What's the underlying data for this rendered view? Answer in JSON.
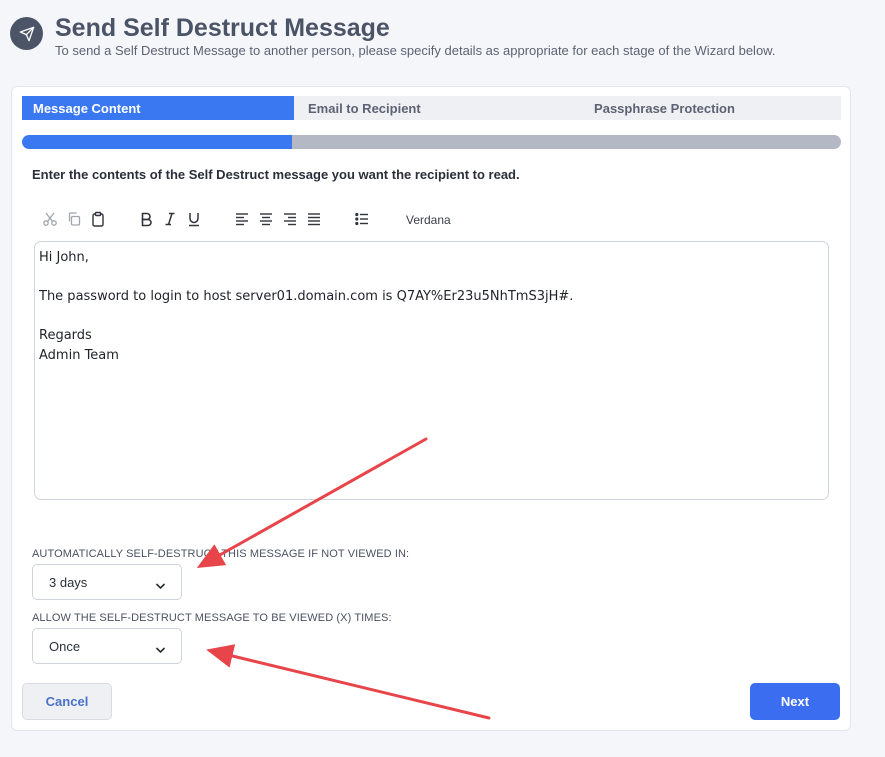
{
  "header": {
    "title": "Send Self Destruct Message",
    "subtitle": "To send a Self Destruct Message to another person, please specify details as appropriate for each stage of the Wizard below."
  },
  "tabs": [
    {
      "label": "Message Content",
      "active": true
    },
    {
      "label": "Email to Recipient",
      "active": false
    },
    {
      "label": "Passphrase Protection",
      "active": false
    }
  ],
  "progress": {
    "fraction": 0.33
  },
  "instruction": "Enter the contents of the Self Destruct message you want the recipient to read.",
  "toolbar": {
    "icons": [
      "cut-icon",
      "copy-icon",
      "paste-icon",
      "bold-icon",
      "italic-icon",
      "underline-icon",
      "align-left-icon",
      "align-center-icon",
      "align-right-icon",
      "align-justify-icon",
      "bullet-list-icon"
    ],
    "font": "Verdana"
  },
  "editor": {
    "lines": [
      "Hi John,",
      "",
      "The password to login to host server01.domain.com is Q7AY%Er23u5NhTmS3jH#.",
      "",
      "Regards",
      "Admin Team"
    ]
  },
  "expiry": {
    "label": "AUTOMATICALLY SELF-DESTRUCT THIS MESSAGE IF NOT VIEWED IN:",
    "value": "3 days"
  },
  "views": {
    "label": "ALLOW THE SELF-DESTRUCT MESSAGE TO BE VIEWED (X) TIMES:",
    "value": "Once"
  },
  "buttons": {
    "cancel": "Cancel",
    "next": "Next"
  },
  "colors": {
    "accent": "#3a78f2",
    "annotation_arrow": "#e8454a"
  }
}
